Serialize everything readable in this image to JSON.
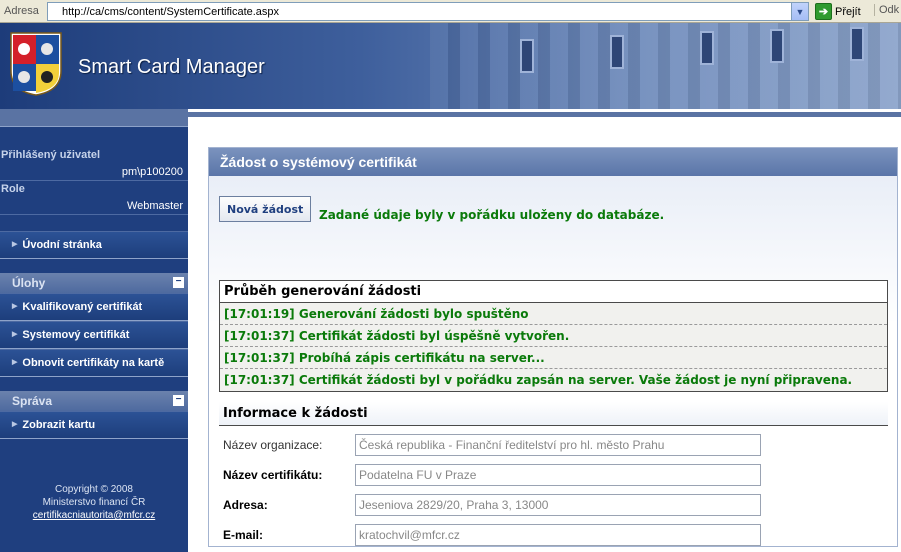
{
  "browser": {
    "address_label": "Adresa",
    "url": "http://ca/cms/content/SystemCertificate.aspx",
    "go_label": "Přejít",
    "links_label": "Odk"
  },
  "header": {
    "app_title": "Smart Card Manager"
  },
  "sidebar": {
    "user_label": "Přihlášený uživatel",
    "user_value": "pm\\p100200",
    "role_label": "Role",
    "role_value": "Webmaster",
    "home_link": "Úvodní stránka",
    "tasks_section": "Úlohy",
    "tasks": [
      "Kvalifikovaný certifikát",
      "Systemový certifikát",
      "Obnovit certifikáty na kartě"
    ],
    "admin_section": "Správa",
    "admin_items": [
      "Zobrazit kartu"
    ],
    "toggle_symbol": "−",
    "footer": {
      "copyright": "Copyright © 2008",
      "org": "Ministerstvo financí ČR",
      "email": "certifikacniautorita@mfcr.cz"
    }
  },
  "main": {
    "title": "Žádost o systémový certifikát",
    "new_request_button": "Nová žádost",
    "success_message": "Zadané údaje byly v pořádku uloženy do databáze.",
    "progress": {
      "heading": "Průběh generování žádosti",
      "log": [
        "[17:01:19] Generování žádosti bylo spuštěno",
        "[17:01:37] Certifikát žádosti byl úspěšně vytvořen.",
        "[17:01:37] Probíhá zápis certifikátu na server...",
        "[17:01:37] Certifikát žádosti byl v pořádku zapsán na server. Vaše žádost je nyní připravena."
      ]
    },
    "info": {
      "heading": "Informace k žádosti",
      "fields": [
        {
          "label": "Název organizace:",
          "value": "Česká republika - Finanční ředitelství pro hl. město Prahu"
        },
        {
          "label": "Název certifikátu:",
          "value": "Podatelna FU v Praze"
        },
        {
          "label": "Adresa:",
          "value": "Jeseniova 2829/20, Praha 3, 13000"
        },
        {
          "label": "E-mail:",
          "value": "kratochvil@mfcr.cz"
        }
      ]
    }
  },
  "colors": {
    "sidebar_bg": "#1f3f7f",
    "success_green": "#0a7a0a",
    "panel_title_bg": "#5a75a8"
  }
}
